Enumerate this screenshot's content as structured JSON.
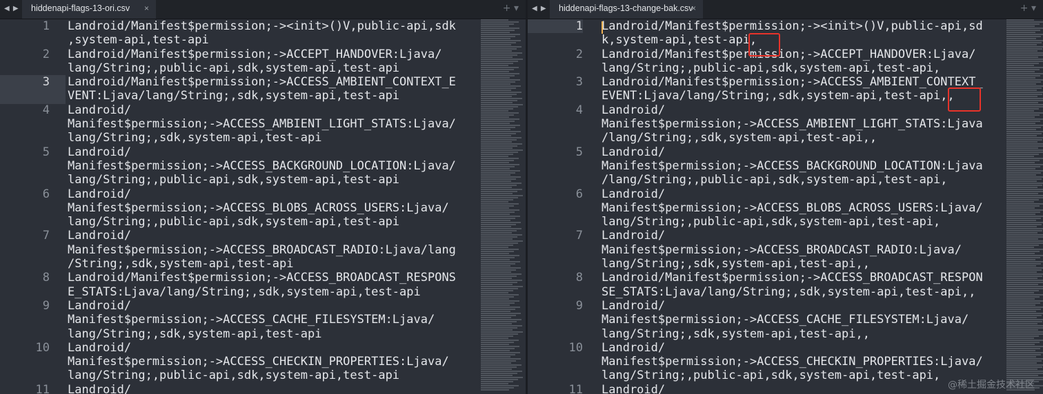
{
  "panes": [
    {
      "tab_title": "hiddenapi-flags-13-ori.csv",
      "close_icon": "×",
      "nav_icon": "◀ ▶",
      "add_icon": "+ ▾",
      "lines": [
        {
          "number": "1",
          "text": "Landroid/Manifest$permission;-><init>()V,public-api,sdk\n,system-api,test-api"
        },
        {
          "number": "2",
          "text": "Landroid/Manifest$permission;->ACCEPT_HANDOVER:Ljava/\nlang/String;,public-api,sdk,system-api,test-api"
        },
        {
          "number": "3",
          "text": "Landroid/Manifest$permission;->ACCESS_AMBIENT_CONTEXT_E\nVENT:Ljava/lang/String;,sdk,system-api,test-api"
        },
        {
          "number": "4",
          "text": "Landroid/\nManifest$permission;->ACCESS_AMBIENT_LIGHT_STATS:Ljava/\nlang/String;,sdk,system-api,test-api"
        },
        {
          "number": "5",
          "text": "Landroid/\nManifest$permission;->ACCESS_BACKGROUND_LOCATION:Ljava/\nlang/String;,public-api,sdk,system-api,test-api"
        },
        {
          "number": "6",
          "text": "Landroid/\nManifest$permission;->ACCESS_BLOBS_ACROSS_USERS:Ljava/\nlang/String;,public-api,sdk,system-api,test-api"
        },
        {
          "number": "7",
          "text": "Landroid/\nManifest$permission;->ACCESS_BROADCAST_RADIO:Ljava/lang\n/String;,sdk,system-api,test-api"
        },
        {
          "number": "8",
          "text": "Landroid/Manifest$permission;->ACCESS_BROADCAST_RESPONS\nE_STATS:Ljava/lang/String;,sdk,system-api,test-api"
        },
        {
          "number": "9",
          "text": "Landroid/\nManifest$permission;->ACCESS_CACHE_FILESYSTEM:Ljava/\nlang/String;,sdk,system-api,test-api"
        },
        {
          "number": "10",
          "text": "Landroid/\nManifest$permission;->ACCESS_CHECKIN_PROPERTIES:Ljava/\nlang/String;,public-api,sdk,system-api,test-api"
        },
        {
          "number": "11",
          "text": "Landroid/"
        }
      ]
    },
    {
      "tab_title": "hiddenapi-flags-13-change-bak.csv",
      "close_icon": "×",
      "nav_icon": "◀ ▶",
      "add_icon": "+ ▾",
      "lines": [
        {
          "number": "1",
          "text": "Landroid/Manifest$permission;-><init>()V,public-api,sd\nk,system-api,test-api,"
        },
        {
          "number": "2",
          "text": "Landroid/Manifest$permission;->ACCEPT_HANDOVER:Ljava/\nlang/String;,public-api,sdk,system-api,test-api,"
        },
        {
          "number": "3",
          "text": "Landroid/Manifest$permission;->ACCESS_AMBIENT_CONTEXT_\nEVENT:Ljava/lang/String;,sdk,system-api,test-api,,"
        },
        {
          "number": "4",
          "text": "Landroid/\nManifest$permission;->ACCESS_AMBIENT_LIGHT_STATS:Ljava\n/lang/String;,sdk,system-api,test-api,,"
        },
        {
          "number": "5",
          "text": "Landroid/\nManifest$permission;->ACCESS_BACKGROUND_LOCATION:Ljava\n/lang/String;,public-api,sdk,system-api,test-api,"
        },
        {
          "number": "6",
          "text": "Landroid/\nManifest$permission;->ACCESS_BLOBS_ACROSS_USERS:Ljava/\nlang/String;,public-api,sdk,system-api,test-api,"
        },
        {
          "number": "7",
          "text": "Landroid/\nManifest$permission;->ACCESS_BROADCAST_RADIO:Ljava/\nlang/String;,sdk,system-api,test-api,,"
        },
        {
          "number": "8",
          "text": "Landroid/Manifest$permission;->ACCESS_BROADCAST_RESPON\nSE_STATS:Ljava/lang/String;,sdk,system-api,test-api,,"
        },
        {
          "number": "9",
          "text": "Landroid/\nManifest$permission;->ACCESS_CACHE_FILESYSTEM:Ljava/\nlang/String;,sdk,system-api,test-api,,"
        },
        {
          "number": "10",
          "text": "Landroid/\nManifest$permission;->ACCESS_CHECKIN_PROPERTIES:Ljava/\nlang/String;,public-api,sdk,system-api,test-api,"
        },
        {
          "number": "11",
          "text": "Landroid/"
        }
      ]
    }
  ],
  "highlighted_line_left": "3",
  "highlighted_line_right": "1",
  "annotation_color": "#e8332a",
  "watermark": "@稀土掘金技术社区"
}
